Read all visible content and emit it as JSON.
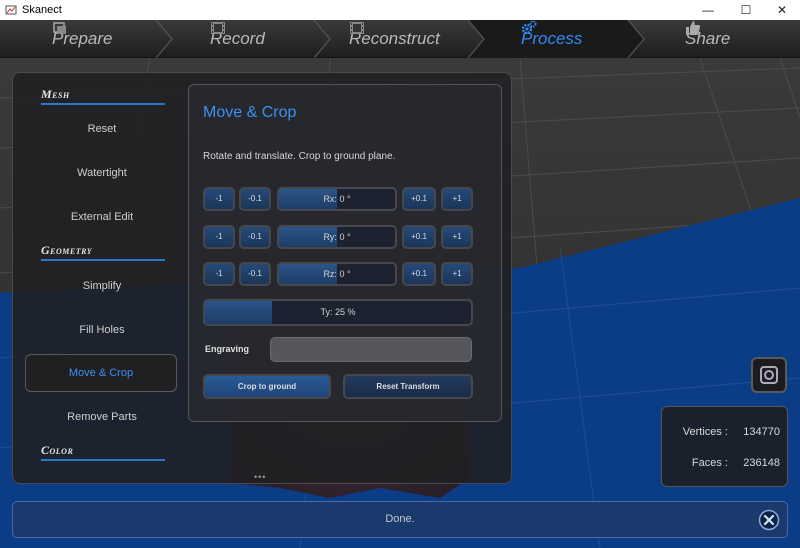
{
  "window": {
    "title": "Skanect",
    "minimize": "—",
    "maximize": "☐",
    "close": "✕"
  },
  "tabs": [
    {
      "label": "Prepare",
      "icon": "prepare-icon",
      "active": false
    },
    {
      "label": "Record",
      "icon": "record-film-icon",
      "active": false
    },
    {
      "label": "Reconstruct",
      "icon": "reconstruct-film-icon",
      "active": false
    },
    {
      "label": "Process",
      "icon": "gears-icon",
      "active": true
    },
    {
      "label": "Share",
      "icon": "thumbs-up-icon",
      "active": false
    }
  ],
  "sidebar": {
    "sections": {
      "mesh": "Mesh",
      "geometry": "Geometry",
      "color": "Color"
    },
    "items": {
      "reset": "Reset",
      "watertight": "Watertight",
      "external_edit": "External Edit",
      "simplify": "Simplify",
      "fill_holes": "Fill Holes",
      "move_crop": "Move & Crop",
      "remove_parts": "Remove Parts"
    }
  },
  "move_crop": {
    "title": "Move & Crop",
    "description": "Rotate and translate. Crop to ground plane.",
    "minus1": "-1",
    "minus01": "-0.1",
    "plus01": "+0.1",
    "plus1": "+1",
    "rx": "Rx: 0 °",
    "ry": "Ry: 0 °",
    "rz": "Rz: 0 °",
    "ty": "Ty: 25 %",
    "ty_value": 25,
    "engraving_label": "Engraving",
    "engraving_value": "",
    "crop_button": "Crop to ground",
    "reset_button": "Reset Transform"
  },
  "stats": {
    "vertices_label": "Vertices :",
    "vertices_value": "134770",
    "faces_label": "Faces :",
    "faces_value": "236148"
  },
  "status": {
    "message": "Done."
  },
  "colors": {
    "accent": "#2f8cf2",
    "button": "#1f3e68",
    "ground": "#0a3d86"
  }
}
